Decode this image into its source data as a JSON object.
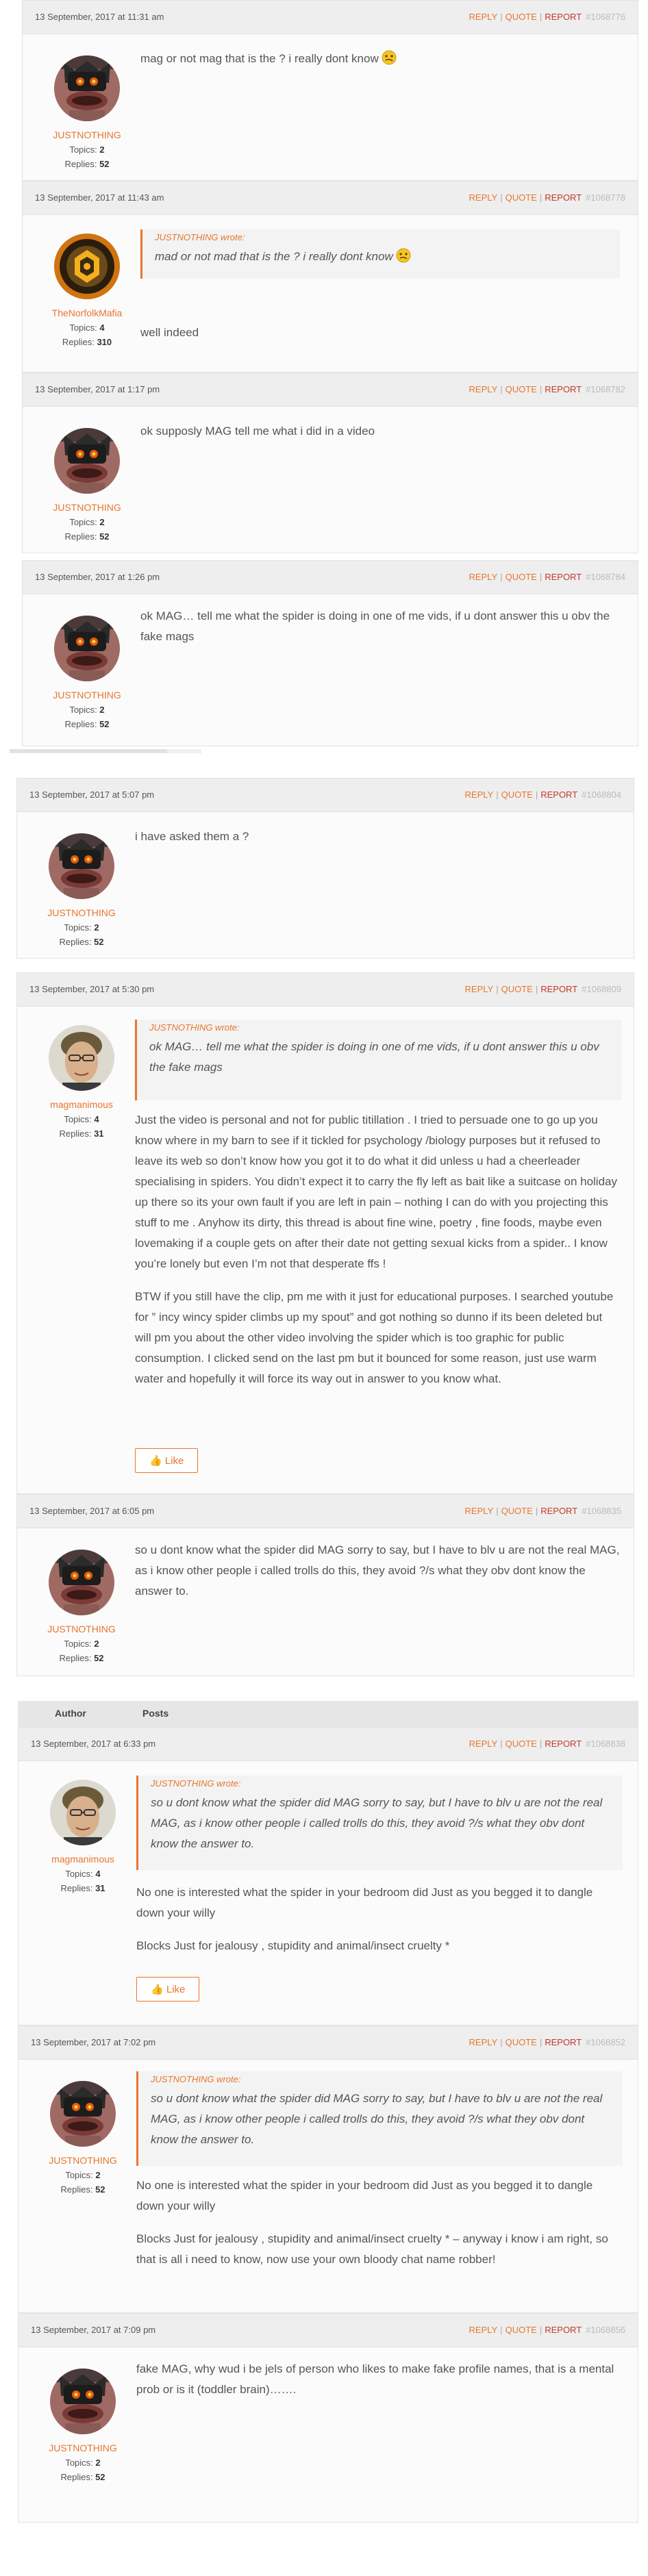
{
  "actions": {
    "reply": "REPLY",
    "quote": "QUOTE",
    "report": "REPORT",
    "like": "Like"
  },
  "users": {
    "justnothing": {
      "name": "JUSTNOTHING",
      "topics": "2",
      "replies": "52"
    },
    "norfolk": {
      "name": "TheNorfolkMafia",
      "topics": "4",
      "replies": "310"
    },
    "magmanimous": {
      "name": "magmanimous",
      "topics": "4",
      "replies": "31"
    }
  },
  "labels": {
    "topics": "Topics:",
    "replies": "Replies:",
    "wrote": "JUSTNOTHING wrote:"
  },
  "table_headers": {
    "author": "Author",
    "posts": "Posts"
  },
  "posts": [
    {
      "date": "13 September, 2017 at 11:31 am",
      "id": "#1068776",
      "text": "mag or not mag that is the ? i really dont know"
    },
    {
      "date": "13 September, 2017 at 11:43 am",
      "id": "#1068778",
      "quote": "mad or not mad that is the ? i really dont know",
      "text": "well indeed"
    },
    {
      "date": "13 September, 2017 at 1:17 pm",
      "id": "#1068782",
      "text": "ok supposly MAG tell me what i did in a video"
    },
    {
      "date": "13 September, 2017 at 1:26 pm",
      "id": "#1068784",
      "text": "ok MAG… tell me what the spider is doing in one of me vids, if u dont answer this u obv the fake mags"
    },
    {
      "date": "13 September, 2017 at 5:07 pm",
      "id": "#1068804",
      "text": "i have asked them a ?"
    },
    {
      "date": "13 September, 2017 at 5:30 pm",
      "id": "#1068809",
      "quote": "ok MAG… tell me what the spider is doing in one of me vids, if u dont answer this u obv the fake mags",
      "p1": "Just the video is personal and not for public titillation  . I tried to persuade one to go up you know where in my barn to see if it tickled for psychology /biology purposes but it refused to leave its web so don’t know how you got it to do what it did unless u had a cheerleader specialising in spiders. You didn’t expect it to carry the fly left as bait like a suitcase  on holiday  up there so its your own fault if you are left in pain – nothing  I can do with you projecting this stuff to me . Anyhow its dirty, this thread is about fine wine, poetry , fine foods, maybe even lovemaking if a couple gets on after their date not getting sexual kicks from a spider.. I know you’re lonely but even I’m not that desperate ffs !",
      "p2": "BTW if you still have the clip, pm me with it just for educational purposes.  I searched youtube for ” incy wincy spider climbs up my spout” and got nothing so dunno if its been deleted but will pm you about the other video involving the spider which is too graphic for public consumption.  I clicked send on the last pm but it bounced for some reason, just use warm water and hopefully it will force its way out in answer to you know what."
    },
    {
      "date": "13 September, 2017 at 6:05 pm",
      "id": "#1068835",
      "text": "so u dont know what the spider did MAG sorry to say, but I have to blv u are not the real MAG, as i know other people i called trolls do this, they avoid ?/s what they obv dont know the answer to."
    },
    {
      "date": "13 September, 2017 at 6:33 pm",
      "id": "#1068838",
      "quote": "so u dont know what the spider did MAG sorry to say, but I have to blv u are not the real MAG, as i know other people i called trolls do this, they avoid ?/s what they obv dont know the answer to.",
      "p1": "No one is interested what the spider in your bedroom did Just as you begged it to dangle down your willy",
      "p2": "Blocks Just for jealousy  , stupidity and animal/insect cruelty *"
    },
    {
      "date": "13 September, 2017 at 7:02 pm",
      "id": "#1068852",
      "quote": "so u dont know what the spider did MAG sorry to say, but I have to blv u are not the real MAG, as i know other people i called trolls do this, they avoid ?/s what they obv dont know the answer to.",
      "p1": "No one is interested what the spider in your bedroom did Just as you begged it to dangle down your willy",
      "p2": "Blocks Just for jealousy  , stupidity and animal/insect cruelty * – anyway i know i am right, so that is all i need to know, now use your own bloody chat name robber!"
    },
    {
      "date": "13 September, 2017 at 7:09 pm",
      "id": "#1068856",
      "text": "fake MAG, why wud i be jels of person who likes to make fake profile names, that is a mental prob or is it (toddler brain)……."
    }
  ]
}
